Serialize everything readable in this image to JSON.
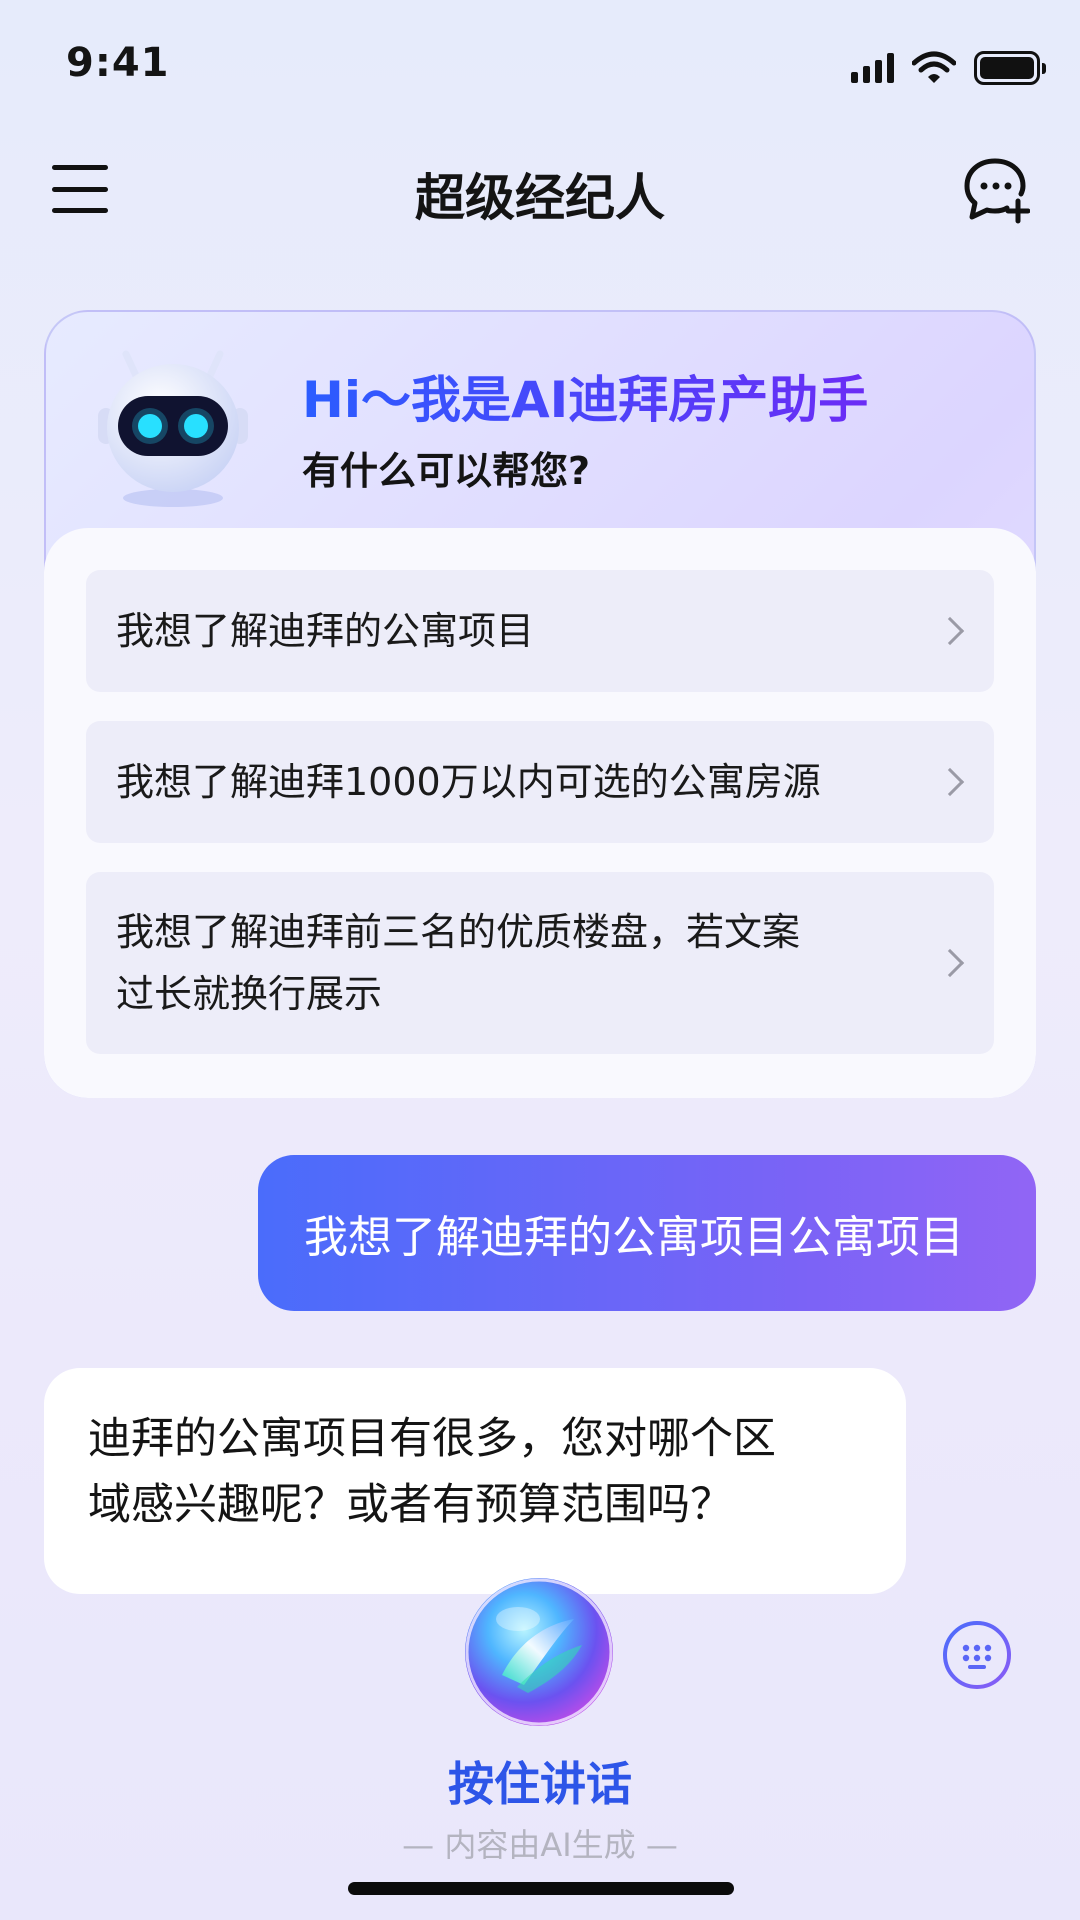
{
  "status_bar": {
    "time": "9:41"
  },
  "nav": {
    "title": "超级经纪人"
  },
  "welcome": {
    "heading": "Hi～我是AI迪拜房产助手",
    "subheading": "有什么可以帮您?"
  },
  "suggestions": [
    {
      "line1": "我想了解迪拜的公寓项目",
      "line2": ""
    },
    {
      "line1": "我想了解迪拜1000万以内可选的公寓房源",
      "line2": ""
    },
    {
      "line1": "我想了解迪拜前三名的优质楼盘，若文案",
      "line2": "过长就换行展示"
    }
  ],
  "messages": {
    "user": "我想了解迪拜的公寓项目公寓项目",
    "assistant_line1": "迪拜的公寓项目有很多，您对哪个区",
    "assistant_line2": "域感兴趣呢？或者有预算范围吗？"
  },
  "voice": {
    "hold_label": "按住讲话",
    "disclaimer": "— 内容由AI生成 —"
  },
  "colors": {
    "accent_blue": "#2d55e8",
    "bubble_gradient_start": "#4a6cfb",
    "bubble_gradient_end": "#9165f5",
    "heading_gradient_start": "#2b5dff",
    "heading_gradient_end": "#6b2cf5"
  },
  "icons": {
    "menu": "menu-icon",
    "new_chat": "chat-plus-icon",
    "robot": "robot-avatar-icon",
    "chevron": "chevron-right-icon",
    "voice": "voice-orb-icon",
    "keyboard": "keyboard-icon"
  }
}
